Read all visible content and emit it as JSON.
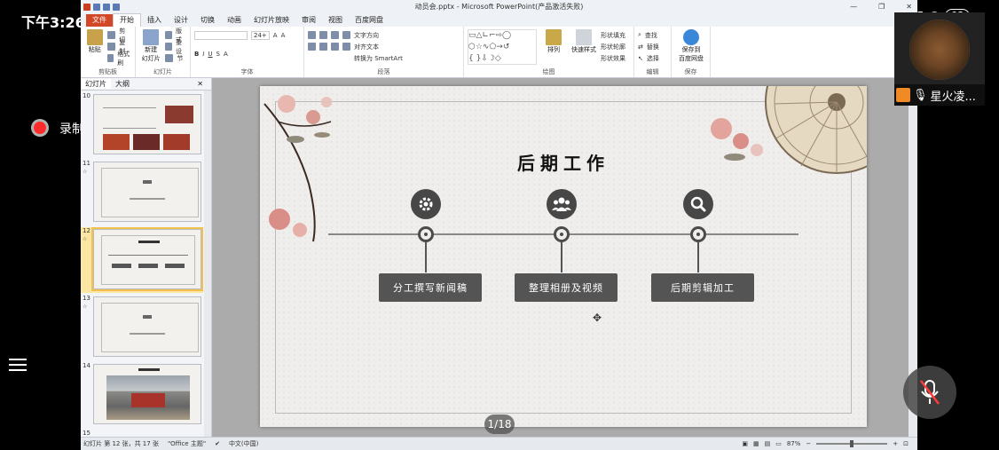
{
  "phone": {
    "time": "下午3:26",
    "battery": "93",
    "recording_label": "录制中",
    "participant_name": "星火凌...",
    "page_indicator": "1/18"
  },
  "window": {
    "title": "动员会.pptx - Microsoft PowerPoint(产品激活失败)"
  },
  "ribbon_tabs": [
    "文件",
    "开始",
    "插入",
    "设计",
    "切换",
    "动画",
    "幻灯片放映",
    "审阅",
    "视图",
    "百度网盘"
  ],
  "ribbon": {
    "paste": "粘贴",
    "cut": "剪切",
    "copy": "复制",
    "format_painter": "格式刷",
    "clipboard": "剪贴板",
    "new_slide": "新建\n幻灯片",
    "layout": "版式",
    "reset": "重设",
    "section": "节",
    "slides_group": "幻灯片",
    "font_group": "字体",
    "font_size": "24+",
    "text_direction": "文字方向",
    "align_text": "对齐文本",
    "smartart": "转换为 SmartArt",
    "paragraph_group": "段落",
    "arrange": "排列",
    "quick_styles": "快速样式",
    "shape_fill": "形状填充",
    "shape_outline": "形状轮廓",
    "shape_effects": "形状效果",
    "drawing_group": "绘图",
    "find": "查找",
    "replace": "替换",
    "select": "选择",
    "editing_group": "编辑",
    "save_to_baidu": "保存到\n百度网盘",
    "save_group": "保存"
  },
  "left_pane": {
    "tab_slides": "幻灯片",
    "tab_outline": "大纲",
    "thumbnails": [
      {
        "num": "10"
      },
      {
        "num": "11"
      },
      {
        "num": "12"
      },
      {
        "num": "13"
      },
      {
        "num": "14"
      },
      {
        "num": "15"
      }
    ]
  },
  "slide": {
    "title": "后期工作",
    "items": [
      {
        "label": "分工撰写新闻稿",
        "icon": "gear-icon"
      },
      {
        "label": "整理相册及视频",
        "icon": "people-icon"
      },
      {
        "label": "后期剪辑加工",
        "icon": "search-icon"
      }
    ]
  },
  "statusbar": {
    "slide_info": "幻灯片 第 12 张，共 17 张",
    "theme": "\"Office 主题\"",
    "language": "中文(中国)",
    "zoom": "87%"
  },
  "colors": {
    "file_tab": "#d24726",
    "slide_box": "#545454",
    "recording": "#ff2a2a"
  }
}
